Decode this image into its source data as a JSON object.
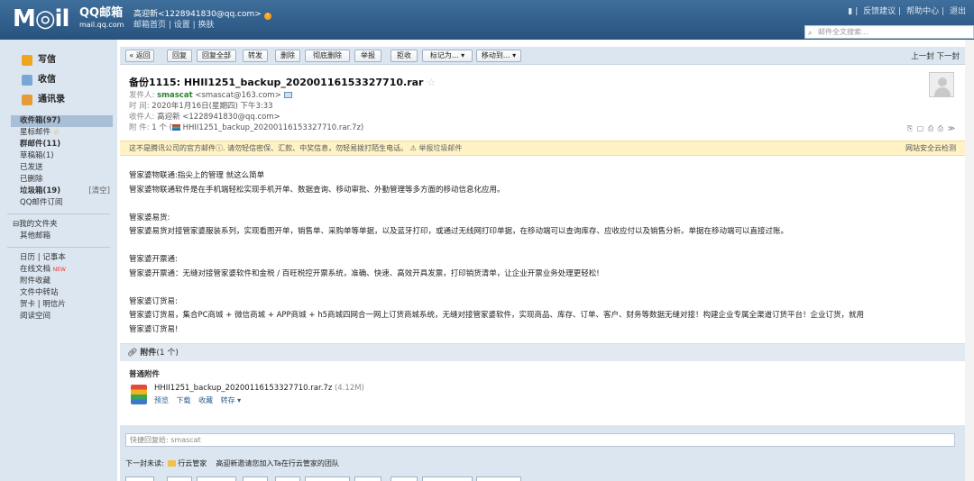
{
  "header": {
    "logo_text": "M◎il",
    "brand": "QQ邮箱",
    "domain": "mail.qq.com",
    "user_display": "高迎新<1228941830@qq.com>",
    "user_badge": "!",
    "user_links": "邮箱首页 | 设置 | 换肤",
    "top_links": [
      "反馈建议",
      "帮助中心",
      "退出"
    ],
    "search_placeholder": "邮件全文搜索..."
  },
  "sidebar": {
    "compose": "写信",
    "inbox": "收信",
    "contacts": "通讯录",
    "folders": [
      {
        "label": "收件箱(97)",
        "active": true
      },
      {
        "label": "星标邮件",
        "star": "☆"
      },
      {
        "label": "群邮件(11)",
        "bold": true
      },
      {
        "label": "草稿箱(1)"
      },
      {
        "label": "已发送"
      },
      {
        "label": "已删除"
      },
      {
        "label": "垃圾箱(19)",
        "bold": true,
        "right": "[清空]"
      },
      {
        "label": "QQ邮件订阅"
      }
    ],
    "my_folders": "⊟我的文件夹",
    "other_mail": "其他邮箱",
    "tools": [
      {
        "label": "日历 | 记事本"
      },
      {
        "label": "在线文档",
        "badge": "NEW"
      },
      {
        "label": "附件收藏"
      },
      {
        "label": "文件中转站"
      },
      {
        "label": "贺卡 | 明信片"
      },
      {
        "label": "阅读空间"
      }
    ]
  },
  "toolbar": {
    "back": "« 返回",
    "reply": "回复",
    "reply_all": "回复全部",
    "forward": "转发",
    "delete": "删除",
    "delete_perm": "彻底删除",
    "report": "举报",
    "reject": "拒收",
    "mark_as": "标记为... ▾",
    "move_to": "移动到... ▾",
    "pager": "上一封 下一封"
  },
  "email": {
    "subject": "备份1115: HHII1251_backup_20200116153327710.rar",
    "subject_star": "☆",
    "from_label": "发件人:",
    "from_name": "smascat",
    "from_addr": "<smascat@163.com>",
    "time_label": "时  间:",
    "time": "2020年1月16日(星期四) 下午3:33",
    "to_label": "收件人:",
    "to": "高迎新 <1228941830@qq.com>",
    "attach_label": "附  件:",
    "attach_count": "1 个 (",
    "attach_file": "HHII1251_backup_20200116153327710.rar.7z",
    "attach_close": ")",
    "tools_icons": "⎘ ▢ ⎙ ⎙ ≫"
  },
  "warning": {
    "text": "这不是腾讯公司的官方邮件ⓘ.  请勿轻信密保、汇款、中奖信息，勿轻易拨打陌生电话。",
    "report": "举报垃圾邮件",
    "right": "网站安全云检测"
  },
  "body": {
    "lines": [
      "管家婆物联通:指尖上的管理 就这么简单",
      "管家婆物联通软件是在手机端轻松实现手机开单、数据查询、移动审批、外勤管理等多方面的移动信息化应用。",
      "",
      "管家婆易货:",
      "管家婆易货对接管家婆服装系列，实现看图开单，销售单、采购单等单据，以及蓝牙打印，或通过无线网打印单据，在移动端可以查询库存、应收应付以及销售分析。单据在移动端可以直接过账。",
      "",
      "管家婆开票通:",
      "管家婆开票通：无缝对接管家婆软件和金税 / 百旺税控开票系统，准确、快速、高效开具发票，打印销货清单，让企业开票业务处理更轻松!",
      "",
      "管家婆订货易:",
      "管家婆订货易，集合PC商城 + 微信商城 + APP商城 + h5商城四网合一网上订货商城系统，无缝对接管家婆软件，实现商品、库存、订单、客户、财务等数据无缝对接！构建企业专属全渠道订货平台！企业订货，就用",
      "管家婆订货易!"
    ]
  },
  "attachments": {
    "header_label": "附件",
    "header_count": "(1 个)",
    "section": "普通附件",
    "file_name": "HHII1251_backup_20200116153327710.rar.7z",
    "file_size": "(4.12M)",
    "actions": [
      "预览",
      "下载",
      "收藏",
      "转存 ▾"
    ]
  },
  "reply": {
    "quick_placeholder": "快捷回复给: smascat",
    "next_label": "下一封未读:",
    "next_from": "行云管家",
    "next_subject": "高迎新邀请您加入Ta在行云管家的团队"
  }
}
